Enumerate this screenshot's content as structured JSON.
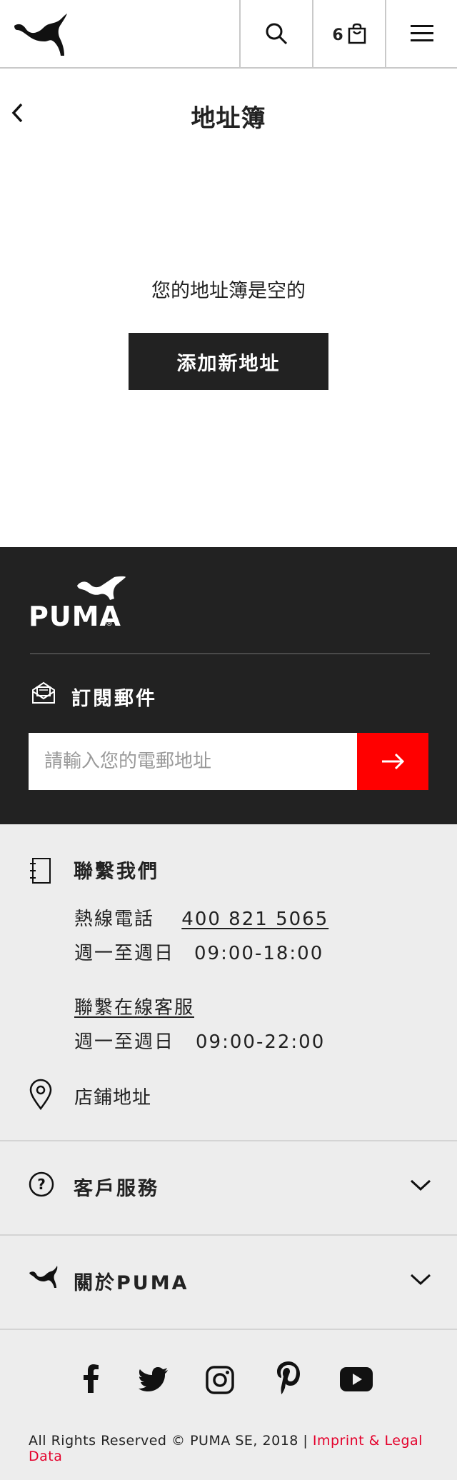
{
  "header": {
    "cart_count": "6"
  },
  "page": {
    "title": "地址簿",
    "empty_message": "您的地址簿是空的",
    "add_button": "添加新地址"
  },
  "newsletter": {
    "title": "訂閱郵件",
    "email_placeholder": "請輸入您的電郵地址"
  },
  "contact": {
    "title": "聯繫我們",
    "hotline_label": "熱線電話",
    "hotline_number": "400 821 5065",
    "hotline_hours_label": "週一至週日",
    "hotline_hours": "09:00-18:00",
    "online_service": "聯繫在線客服",
    "online_hours_label": "週一至週日",
    "online_hours": "09:00-22:00",
    "store_locator": "店鋪地址"
  },
  "accordions": [
    {
      "label": "客戶服務",
      "icon": "question-icon"
    },
    {
      "label": "關於PUMA",
      "icon": "puma-cat-icon"
    }
  ],
  "socials": [
    "facebook-icon",
    "twitter-icon",
    "instagram-icon",
    "pinterest-icon",
    "youtube-icon"
  ],
  "footer": {
    "copyright": "All Rights Reserved © PUMA SE, 2018 | ",
    "imprint": "Imprint & Legal Data"
  },
  "colors": {
    "dark": "#222222",
    "accent_red": "#ff0000",
    "footer_bg": "#ededed",
    "link_red": "#e4002b"
  }
}
